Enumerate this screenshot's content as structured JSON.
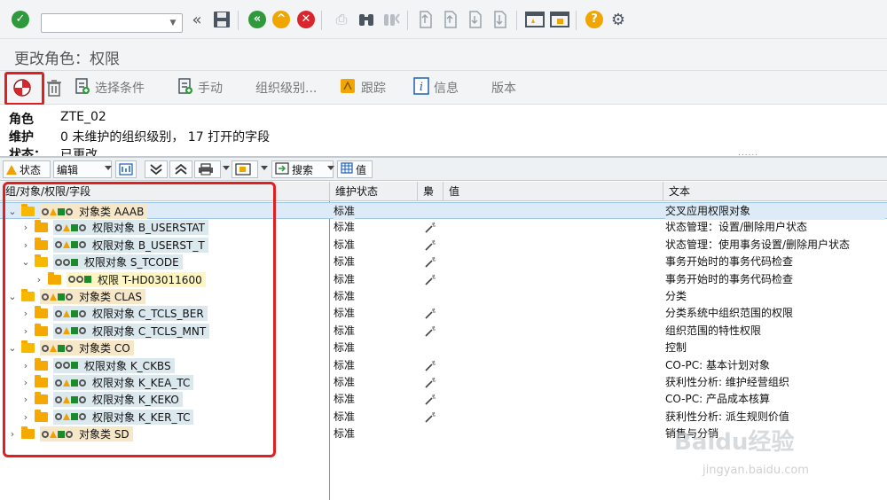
{
  "title": "更改角色：权限",
  "app_toolbar": {
    "select_conditions": "选择条件",
    "manual": "手动",
    "org_levels": "组织级别...",
    "trace": "跟踪",
    "info": "信息",
    "version": "版本"
  },
  "header": {
    "role_label": "角色",
    "role_value": "ZTE_02",
    "maint_label": "维护",
    "maint_value": "0 未维护的组织级别， 17 打开的字段",
    "status_label": "状态：",
    "status_value": "已更改"
  },
  "alv_toolbar": {
    "status": "状态",
    "edit": "编辑",
    "search": "搜索",
    "value": "值"
  },
  "columns": {
    "tree": "组/对象/权限/字段",
    "maint_status": "维护状态",
    "hash": "梟",
    "value": "值",
    "text": "文本"
  },
  "rows": [
    {
      "type": "cls",
      "indent": 0,
      "open": true,
      "node": "对象类 AAAB",
      "status": "标准",
      "text": "交叉应用权限对象",
      "wand": false,
      "sel": true,
      "icons": "ota"
    },
    {
      "type": "obj",
      "indent": 1,
      "open": false,
      "node": "权限对象 B_USERSTAT",
      "status": "标准",
      "text": "状态管理：设置/删除用户状态",
      "wand": true,
      "icons": "ota"
    },
    {
      "type": "obj",
      "indent": 1,
      "open": false,
      "node": "权限对象 B_USERST_T",
      "status": "标准",
      "text": "状态管理：使用事务设置/删除用户状态",
      "wand": true,
      "icons": "ota"
    },
    {
      "type": "obj",
      "indent": 1,
      "open": true,
      "node": "权限对象 S_TCODE",
      "status": "标准",
      "text": "事务开始时的事务代码检查",
      "wand": true,
      "icons": "oos"
    },
    {
      "type": "auth",
      "indent": 2,
      "open": false,
      "node": "权限 T-HD03011600",
      "status": "标准",
      "text": "事务开始时的事务代码检查",
      "wand": true,
      "icons": "oos"
    },
    {
      "type": "cls",
      "indent": 0,
      "open": true,
      "node": "对象类 CLAS",
      "status": "标准",
      "text": "分类",
      "wand": false,
      "icons": "ota"
    },
    {
      "type": "obj",
      "indent": 1,
      "open": false,
      "node": "权限对象 C_TCLS_BER",
      "status": "标准",
      "text": "分类系统中组织范围的权限",
      "wand": true,
      "icons": "ota"
    },
    {
      "type": "obj",
      "indent": 1,
      "open": false,
      "node": "权限对象 C_TCLS_MNT",
      "status": "标准",
      "text": "组织范围的特性权限",
      "wand": true,
      "icons": "ota"
    },
    {
      "type": "cls",
      "indent": 0,
      "open": true,
      "node": "对象类 CO",
      "status": "标准",
      "text": "控制",
      "wand": false,
      "icons": "ota"
    },
    {
      "type": "obj",
      "indent": 1,
      "open": false,
      "node": "权限对象 K_CKBS",
      "status": "标准",
      "text": "CO-PC: 基本计划对象",
      "wand": true,
      "icons": "oos"
    },
    {
      "type": "obj",
      "indent": 1,
      "open": false,
      "node": "权限对象 K_KEA_TC",
      "status": "标准",
      "text": "获利性分析: 维护经营组织",
      "wand": true,
      "icons": "ota"
    },
    {
      "type": "obj",
      "indent": 1,
      "open": false,
      "node": "权限对象 K_KEKO",
      "status": "标准",
      "text": "CO-PC: 产品成本核算",
      "wand": true,
      "icons": "ota"
    },
    {
      "type": "obj",
      "indent": 1,
      "open": false,
      "node": "权限对象 K_KER_TC",
      "status": "标准",
      "text": "获利性分析: 派生规则价值",
      "wand": true,
      "icons": "ota"
    },
    {
      "type": "cls",
      "indent": 0,
      "open": false,
      "node": "对象类 SD",
      "status": "标准",
      "text": "销售与分销",
      "wand": false,
      "icons": "ota"
    }
  ],
  "watermark": "Baidu经验",
  "watermark_url": "jingyan.baidu.com"
}
